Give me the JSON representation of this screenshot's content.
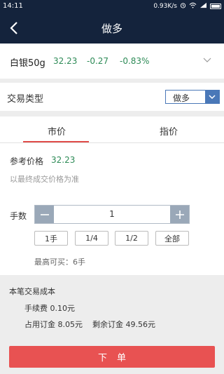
{
  "status_bar": {
    "time": "14:11",
    "network_speed": "0.93K/s"
  },
  "header": {
    "title": "做多"
  },
  "product": {
    "name": "白银50g",
    "price": "32.23",
    "change": "-0.27",
    "change_pct": "-0.83%"
  },
  "trade_type": {
    "label": "交易类型",
    "selected": "做多"
  },
  "tabs": [
    {
      "label": "市价",
      "active": true
    },
    {
      "label": "指价",
      "active": false
    }
  ],
  "market": {
    "ref_price_label": "参考价格",
    "ref_price_value": "32.23",
    "note": "以最终成交价格为准",
    "qty_label": "手数",
    "qty_value": "1",
    "quick_options": [
      "1手",
      "1/4",
      "1/2",
      "全部"
    ],
    "max_buy": "最高可买：6手"
  },
  "cost": {
    "title": "本笔交易成本",
    "fee": "手续费 0.10元",
    "margin": "占用订金 8.05元",
    "remaining": "剩余订金 49.56元"
  },
  "submit_label": "下单",
  "colors": {
    "header_bg": "#14233c",
    "up_green": "#2e8b57",
    "accent_red": "#e85252",
    "select_blue": "#4a78b8"
  }
}
